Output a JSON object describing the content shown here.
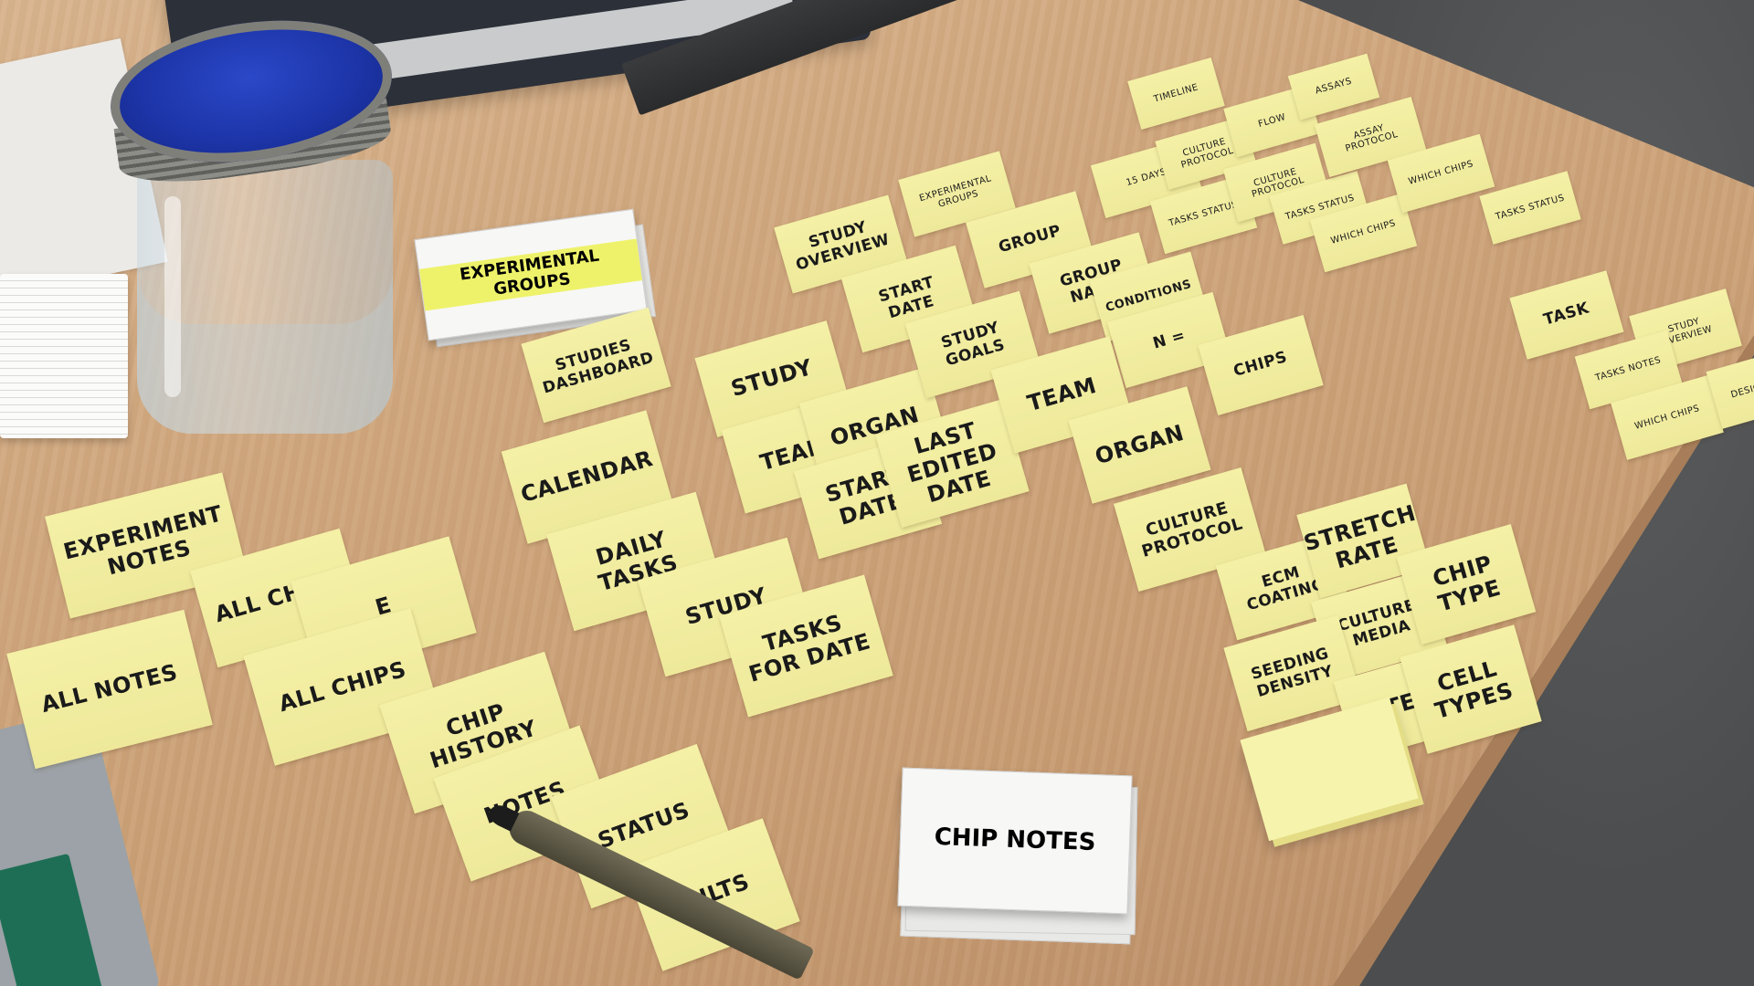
{
  "scene": {
    "description_kind": "photo",
    "subject": "card-sorting workshop on a wooden table"
  },
  "colors": {
    "sticky_note": "#f2ee9f",
    "table_wood": "#d0a77e",
    "jar_lid": "#1c34a7",
    "floor": "#4b4d4f"
  },
  "notes": {
    "experiment_notes": "Experiment Notes",
    "all_chips_a": "All Chips",
    "partial_e": "E",
    "all_notes": "All Notes",
    "all_chips_b": "All Chips",
    "chip_history": "Chip History",
    "notes": "Notes",
    "status": "Status",
    "results": "Sults",
    "calendar": "Calendar",
    "daily_tasks": "Daily Tasks",
    "study_a": "Study",
    "tasks_for_date": "Tasks for Date",
    "studies_dashboard": "Studies Dashboard",
    "study_b": "Study",
    "team_a": "Team",
    "organ_a": "Organ",
    "start_date_a": "Start Date",
    "last_edited_date": "Last Edited Date",
    "study_overview": "Study Overview",
    "start_date_b": "Start Date",
    "study_goals": "Study Goals",
    "experimental_groups_note": "Experimental Groups",
    "group": "Group",
    "group_name": "Group Name",
    "conditions": "Conditions",
    "n_equals": "n =",
    "team_b": "Team",
    "organ_b": "Organ",
    "chips": "Chips",
    "culture_protocol_a": "Culture Protocol",
    "ecm_coating": "ECM Coating",
    "stretch_rate": "Stretch Rate",
    "culture_media": "Culture Media",
    "chip_type": "Chip Type",
    "seeding_density": "Seeding Density",
    "partial_ate": "Ate",
    "cell_types": "Cell Types",
    "timeline": "Timeline",
    "days": "15 Days",
    "culture_protocol_b": "Culture Protocol",
    "tasks_status": "Tasks Status",
    "flow": "Flow",
    "assays": "Assays",
    "culture_protocol_c": "Culture Protocol",
    "tasks_status_b": "Tasks Status",
    "assay_protocol": "Assay Protocol",
    "which_chips_a": "Which Chips",
    "which_chips_b": "Which Chips",
    "tasks_status_c": "Tasks Status",
    "task": "Task",
    "study_overview_b": "Study Overview",
    "tasks_notes": "Tasks Notes",
    "which_chips_c": "Which Chips",
    "design": "Design"
  },
  "cards": {
    "experimental_groups": "Experimental Groups",
    "chip_notes": "Chip Notes"
  }
}
